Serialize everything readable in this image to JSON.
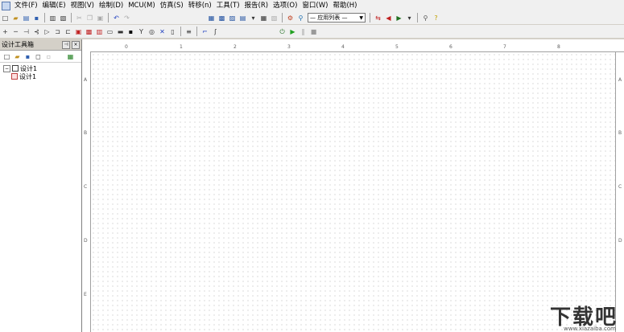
{
  "menus": [
    "文件(F)",
    "编辑(E)",
    "视图(V)",
    "绘制(D)",
    "MCU(M)",
    "仿真(S)",
    "转移(n)",
    "工具(T)",
    "报告(R)",
    "选项(O)",
    "窗口(W)",
    "帮助(H)"
  ],
  "toolbar": {
    "combo_value": "— 应用列表 —"
  },
  "panel": {
    "title": "设计工具箱",
    "tree": {
      "root": "设计1",
      "child": "设计1"
    }
  },
  "ruler": {
    "columns": [
      "0",
      "1",
      "2",
      "3",
      "4",
      "5",
      "6",
      "7",
      "8"
    ],
    "rows": [
      "A",
      "B",
      "C",
      "D",
      "E"
    ]
  },
  "watermark": {
    "text": "下载吧",
    "url": "www.xiazaiba.com"
  }
}
